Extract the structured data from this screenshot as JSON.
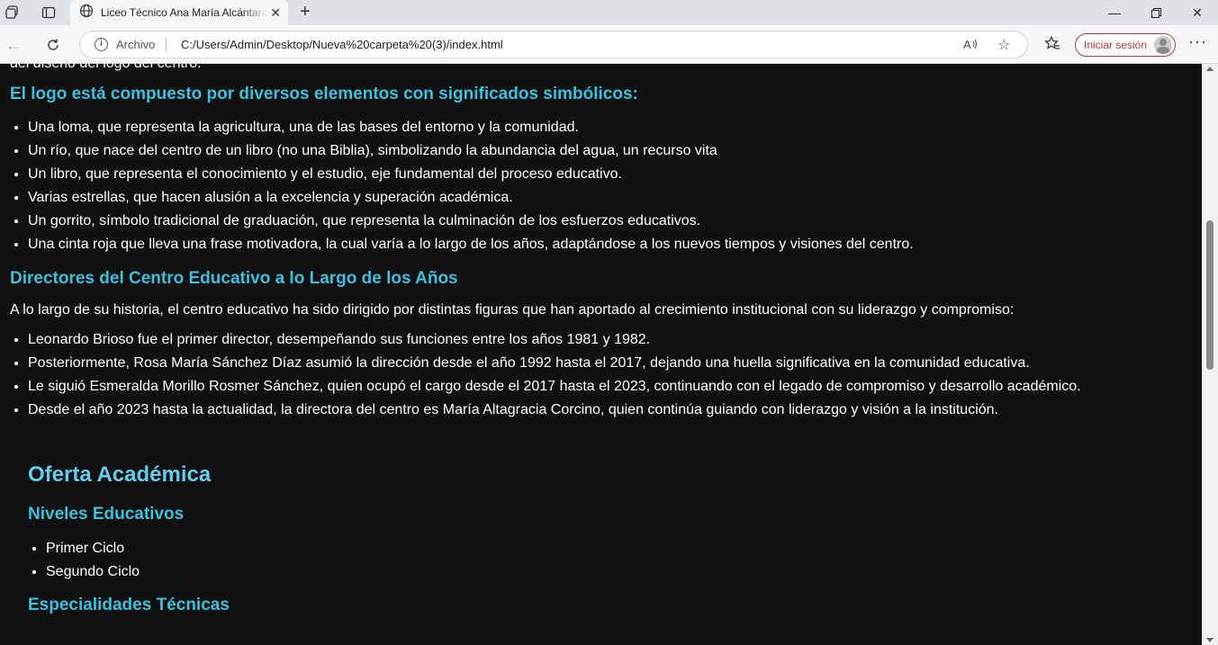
{
  "browser": {
    "tab": {
      "title": "Liceo Técnico Ana María Alcántara"
    },
    "address_bar": {
      "scheme_label": "Archivo",
      "url": "C:/Users/Admin/Desktop/Nueva%20carpeta%20(3)/index.html"
    },
    "signin_label": "Iniciar sesión"
  },
  "page": {
    "intro_cut": "del diseño del logo del centro.",
    "logo_section": {
      "heading": "El logo está compuesto por diversos elementos con significados simbólicos:",
      "items": [
        "Una loma, que representa la agricultura, una de las bases del entorno y la comunidad.",
        "Un río, que nace del centro de un libro (no una Biblia), simbolizando la abundancia del agua, un recurso vita",
        "Un libro, que representa el conocimiento y el estudio, eje fundamental del proceso educativo.",
        "Varias estrellas, que hacen alusión a la excelencia y superación académica.",
        "Un gorrito, símbolo tradicional de graduación, que representa la culminación de los esfuerzos educativos.",
        "Una cinta roja que lleva una frase motivadora, la cual varía a lo largo de los años, adaptándose a los nuevos tiempos y visiones del centro."
      ]
    },
    "directors_section": {
      "heading": "Directores del Centro Educativo a lo Largo de los Años",
      "intro": "A lo largo de su historia, el centro educativo ha sido dirigido por distintas figuras que han aportado al crecimiento institucional con su liderazgo y compromiso:",
      "items": [
        "Leonardo Brioso fue el primer director, desempeñando sus funciones entre los años 1981 y 1982.",
        "Posteriormente, Rosa María Sánchez Díaz asumió la dirección desde el año 1992 hasta el 2017, dejando una huella significativa en la comunidad educativa.",
        "Le siguió Esmeralda Morillo Rosmer Sánchez, quien ocupó el cargo desde el 2017 hasta el 2023, continuando con el legado de compromiso y desarrollo académico.",
        "Desde el año 2023 hasta la actualidad, la directora del centro es María Altagracia Corcino, quien continúa guiando con liderazgo y visión a la institución."
      ]
    },
    "oferta": {
      "title": "Oferta Académica",
      "niveles_heading": "Niveles Educativos",
      "niveles": [
        "Primer Ciclo",
        "Segundo Ciclo"
      ],
      "especialidades_heading": "Especialidades Técnicas"
    }
  },
  "colors": {
    "page_background": "#111111",
    "heading_cyan": "#3ec0dc",
    "title_light_blue": "#66ccee",
    "body_text": "#ffffff",
    "signin_accent": "#b43b3b"
  }
}
